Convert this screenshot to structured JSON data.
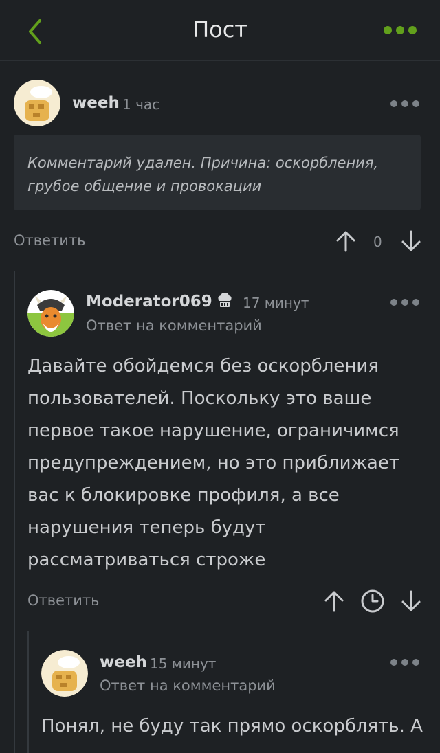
{
  "header": {
    "title": "Пост"
  },
  "comment1": {
    "username": "weeh",
    "time": "1 час",
    "deleted_text": "Комментарий удален. Причина: оскорбления, грубое общение и провокации",
    "reply_label": "Ответить",
    "votes": "0"
  },
  "comment2": {
    "username": "Moderator069",
    "time": "17 минут",
    "subtitle": "Ответ на комментарий",
    "body": "Давайте обойдемся без оскорбления пользователей. Поскольку это ваше первое такое нарушение, ограничимся предупреждением, но это приближает вас к блокировке профиля, а все нарушения теперь будут рассматриваться строже",
    "reply_label": "Ответить"
  },
  "comment3": {
    "username": "weeh",
    "time": "15 минут",
    "subtitle": "Ответ на комментарий",
    "body": "Понял, не буду так прямо оскорблять. А"
  },
  "colors": {
    "accent": "#62a01c",
    "background": "#1e2124",
    "box": "#292d31"
  },
  "icons": [
    "back-arrow-icon",
    "more-icon",
    "arrow-up-icon",
    "arrow-down-icon",
    "clock-icon",
    "chef-hat-icon"
  ]
}
